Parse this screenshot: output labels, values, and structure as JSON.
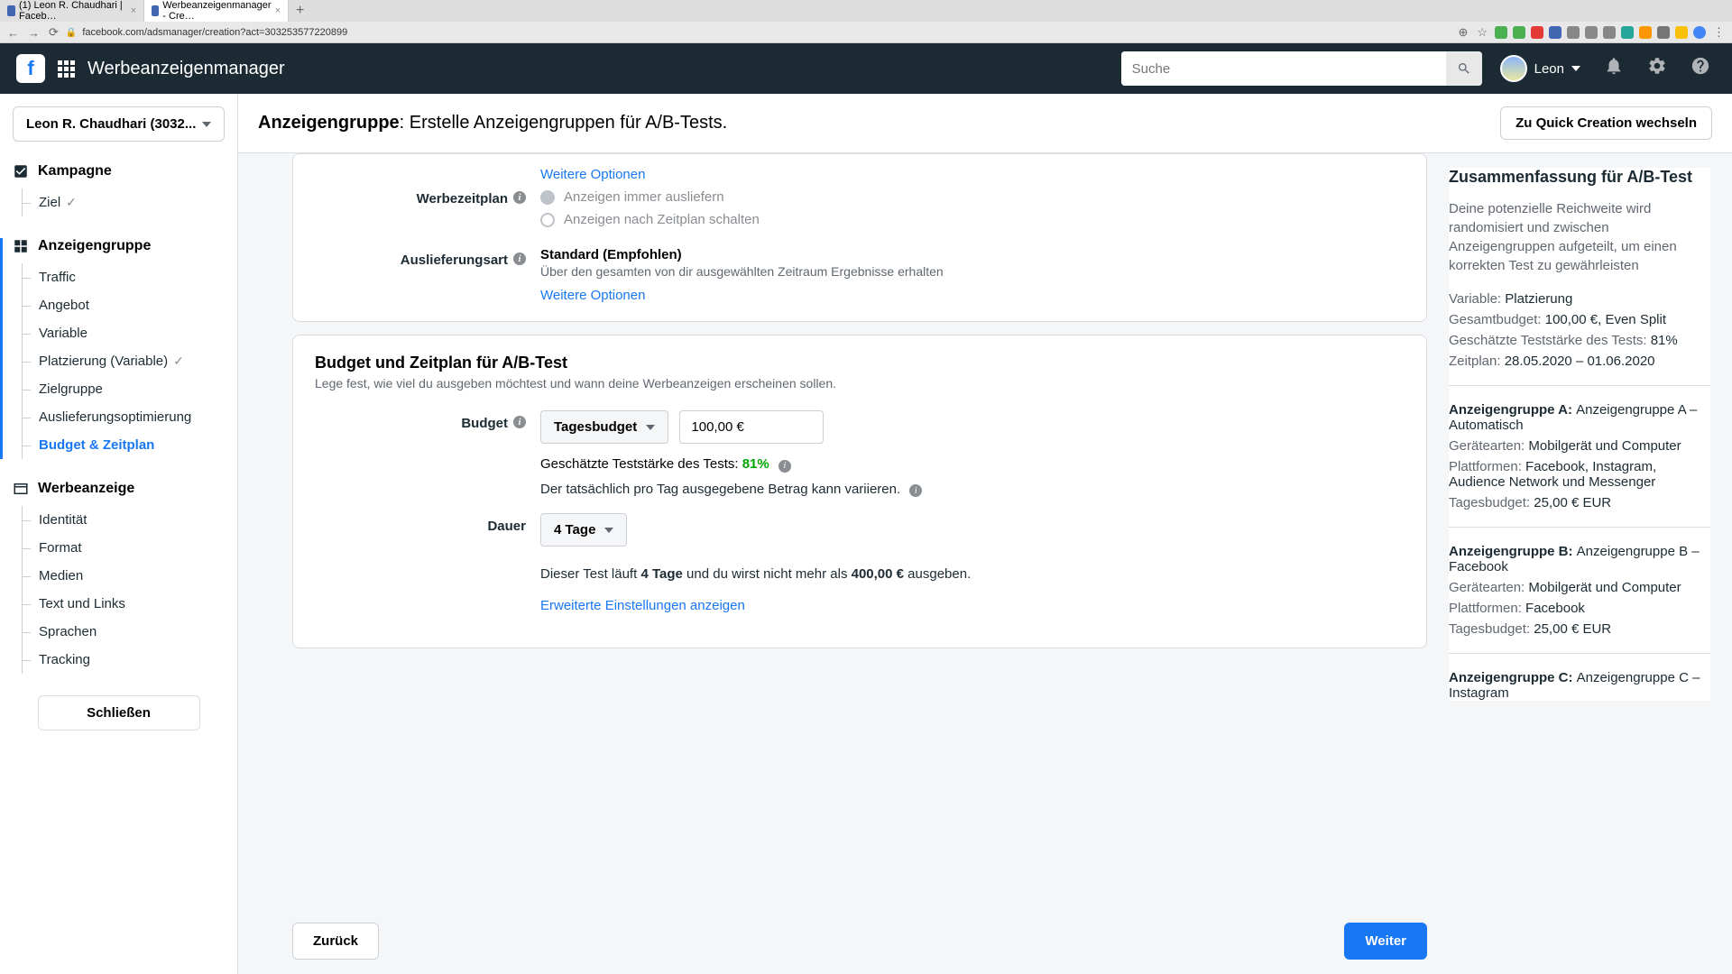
{
  "browser": {
    "tabs": [
      {
        "title": "(1) Leon R. Chaudhari | Faceb…"
      },
      {
        "title": "Werbeanzeigenmanager - Cre…"
      }
    ],
    "url": "facebook.com/adsmanager/creation?act=303253577220899"
  },
  "header": {
    "title": "Werbeanzeigenmanager",
    "search_placeholder": "Suche",
    "user_name": "Leon"
  },
  "sidebar": {
    "account": "Leon R. Chaudhari (3032...",
    "sections": {
      "campaign": {
        "title": "Kampagne",
        "items": [
          "Ziel"
        ]
      },
      "adset": {
        "title": "Anzeigengruppe",
        "items": [
          "Traffic",
          "Angebot",
          "Variable",
          "Platzierung (Variable)",
          "Zielgruppe",
          "Auslieferungsoptimierung",
          "Budget & Zeitplan"
        ]
      },
      "ad": {
        "title": "Werbeanzeige",
        "items": [
          "Identität",
          "Format",
          "Medien",
          "Text und Links",
          "Sprachen",
          "Tracking"
        ]
      }
    },
    "close": "Schließen"
  },
  "content": {
    "title_bold": "Anzeigengruppe",
    "title_rest": ": Erstelle Anzeigengruppen für A/B-Tests.",
    "quick": "Zu Quick Creation wechseln",
    "more_options": "Weitere Optionen",
    "schedule": {
      "label": "Werbezeitplan",
      "opt1": "Anzeigen immer ausliefern",
      "opt2": "Anzeigen nach Zeitplan schalten"
    },
    "delivery": {
      "label": "Auslieferungsart",
      "title": "Standard (Empfohlen)",
      "sub": "Über den gesamten von dir ausgewählten Zeitraum Ergebnisse erhalten"
    },
    "budget_card": {
      "title": "Budget und Zeitplan für A/B-Test",
      "sub": "Lege fest, wie viel du ausgeben möchtest und wann deine Werbeanzeigen erscheinen sollen.",
      "budget_label": "Budget",
      "budget_type": "Tagesbudget",
      "budget_value": "100,00 €",
      "est_label": "Geschätzte Teststärke des Tests: ",
      "est_pct": "81%",
      "note": "Der tatsächlich pro Tag ausgegebene Betrag kann variieren.",
      "duration_label": "Dauer",
      "duration_value": "4 Tage",
      "run_text_1": "Dieser Test läuft ",
      "run_days": "4 Tage",
      "run_text_2": " und du wirst nicht mehr als ",
      "run_amount": "400,00 €",
      "run_text_3": " ausgeben.",
      "advanced": "Erweiterte Einstellungen anzeigen"
    },
    "back": "Zurück",
    "next": "Weiter"
  },
  "summary": {
    "title": "Zusammenfassung für A/B-Test",
    "intro": "Deine potenzielle Reichweite wird randomisiert und zwischen Anzeigengruppen aufgeteilt, um einen korrekten Test zu gewährleisten",
    "variable_k": "Variable: ",
    "variable_v": "Platzierung",
    "budget_k": "Gesamtbudget: ",
    "budget_v": "100,00 €, Even Split",
    "power_k": "Geschätzte Teststärke des Tests: ",
    "power_v": "81%",
    "sched_k": "Zeitplan: ",
    "sched_v": "28.05.2020 – 01.06.2020",
    "groups": [
      {
        "name_k": "Anzeigengruppe A: ",
        "name_v": "Anzeigengruppe A – Automatisch",
        "dev_k": "Gerätearten: ",
        "dev_v": "Mobilgerät und Computer",
        "plat_k": "Plattformen: ",
        "plat_v": "Facebook, Instagram, Audience Network und Messenger",
        "bud_k": "Tagesbudget: ",
        "bud_v": "25,00 € EUR"
      },
      {
        "name_k": "Anzeigengruppe B: ",
        "name_v": "Anzeigengruppe B – Facebook",
        "dev_k": "Gerätearten: ",
        "dev_v": "Mobilgerät und Computer",
        "plat_k": "Plattformen: ",
        "plat_v": "Facebook",
        "bud_k": "Tagesbudget: ",
        "bud_v": "25,00 € EUR"
      },
      {
        "name_k": "Anzeigengruppe C: ",
        "name_v": "Anzeigengruppe C – Instagram"
      }
    ]
  }
}
